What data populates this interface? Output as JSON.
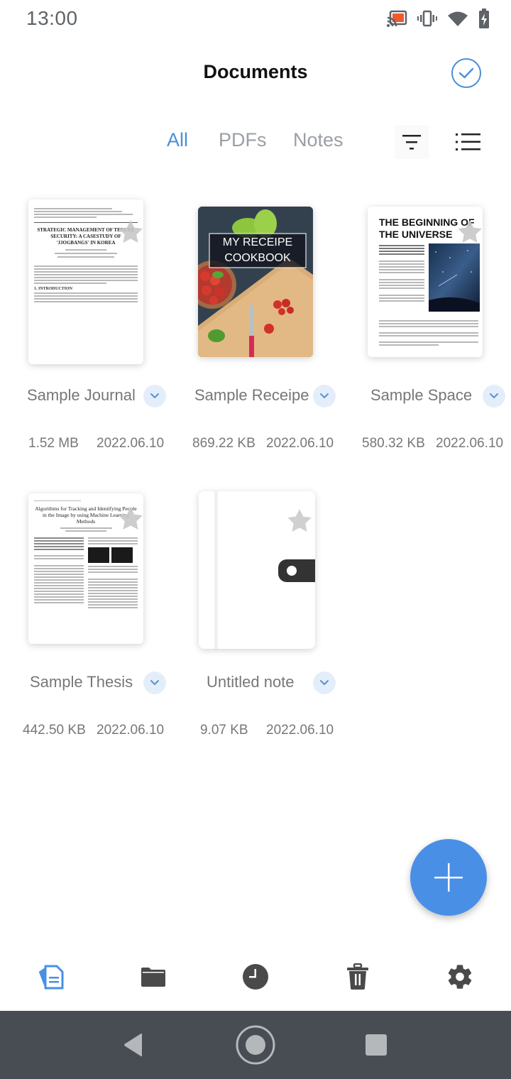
{
  "status_bar": {
    "time": "13:00",
    "icons": [
      "cast-icon",
      "vibrate-icon",
      "wifi-icon",
      "battery-charging-icon"
    ]
  },
  "header": {
    "title": "Documents",
    "select_icon": "check-circle-icon"
  },
  "filters": {
    "tabs": [
      {
        "label": "All",
        "active": true
      },
      {
        "label": "PDFs",
        "active": false
      },
      {
        "label": "Notes",
        "active": false
      }
    ],
    "sort_icon": "sort-filter-icon",
    "view_icon": "list-view-icon"
  },
  "documents": [
    {
      "name": "Sample Journal",
      "size": "1.52 MB",
      "date": "2022.06.10",
      "thumbnail": {
        "type": "paper",
        "title": "STRATEGIC MANAGEMENT OF TENURE SECURITY: A CASESTUDY OF 'JJOGBANGS' IN KOREA",
        "section": "1. INTRODUCTION"
      }
    },
    {
      "name": "Sample Receipe",
      "size": "869.22 KB",
      "date": "2022.06.10",
      "thumbnail": {
        "type": "cookbook",
        "line1": "MY RECEIPE",
        "line2": "COOKBOOK"
      }
    },
    {
      "name": "Sample Space",
      "size": "580.32 KB",
      "date": "2022.06.10",
      "thumbnail": {
        "type": "magazine",
        "title": "THE BEGINNING OF THE UNIVERSE"
      }
    },
    {
      "name": "Sample Thesis",
      "size": "442.50 KB",
      "date": "2022.06.10",
      "thumbnail": {
        "type": "paper",
        "title": "Algorithms for Tracking and Identifying People in the Image by using Machine Learning Methods"
      }
    },
    {
      "name": "Untitled note",
      "size": "9.07 KB",
      "date": "2022.06.10",
      "thumbnail": {
        "type": "notebook"
      }
    }
  ],
  "fab": {
    "icon": "plus-icon"
  },
  "bottom_nav": [
    {
      "name": "documents",
      "icon": "documents-icon",
      "active": true
    },
    {
      "name": "folders",
      "icon": "folder-icon",
      "active": false
    },
    {
      "name": "recent",
      "icon": "clock-icon",
      "active": false
    },
    {
      "name": "trash",
      "icon": "trash-icon",
      "active": false
    },
    {
      "name": "settings",
      "icon": "gear-icon",
      "active": false
    }
  ],
  "system_nav": [
    "back-icon",
    "home-icon",
    "recents-icon"
  ],
  "colors": {
    "accent": "#4a8fd8",
    "fab": "#4a8fe6",
    "inactive_tab": "#9a9ea6",
    "icon_dark": "#4a4a4a",
    "system_nav_bg": "#474d53"
  }
}
